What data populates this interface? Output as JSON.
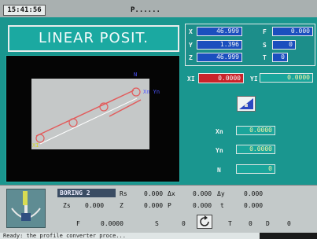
{
  "topbar": {
    "time": "15:41:56",
    "program": "P......"
  },
  "title": "LINEAR POSIT.",
  "coords": {
    "x_label": "X",
    "x_value": "46.999",
    "y_label": "Y",
    "y_value": "1.396",
    "z_label": "Z",
    "z_value": "46.999",
    "f_label": "F",
    "f_value": "0.000",
    "s_label": "S",
    "s_value": "0",
    "t_label": "T",
    "t_value": "0"
  },
  "inputs": {
    "xi_label": "XI",
    "xi_value": "0.0000",
    "yi_label": "YI",
    "yi_value": "0.0000",
    "xn_label": "Xn",
    "xn_value": "0.0000",
    "yn_label": "Yn",
    "yn_value": "0.0000",
    "n_label": "N",
    "n_value": "0"
  },
  "graphic": {
    "label_n": "N",
    "label_xnyn": "Xn Yn",
    "label_xi": "XI"
  },
  "bottom": {
    "cycle": "BORING 2",
    "rows": [
      [
        "Rs",
        "0.000",
        "Δx",
        "0.000",
        "Δy",
        "0.000"
      ],
      [
        "Zs",
        "0.000",
        "Z",
        "0.000",
        "P",
        "0.000",
        "t",
        "0.000"
      ],
      [
        "F",
        "0.0000",
        "S",
        "0",
        "T",
        "0",
        "D",
        "0"
      ]
    ]
  },
  "status": {
    "text": "Ready: the profile converter proce..."
  }
}
